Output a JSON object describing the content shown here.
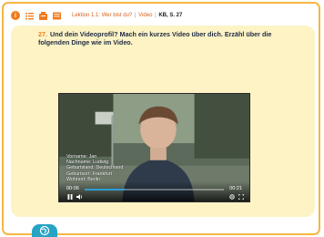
{
  "top_bar": {
    "icons": [
      "info-icon",
      "list-icon",
      "grid-icon",
      "book-icon"
    ],
    "breadcrumb": {
      "lesson": "Lektion 1.1: Wer bist du?",
      "separator": "|",
      "media": "Video",
      "kb": "KB, S. 27"
    }
  },
  "task": {
    "number": "27.",
    "text": "Und dein Videoprofil? Mach ein kurzes Video über dich. Erzähl über die folgenden Dinge wie im Video."
  },
  "video": {
    "caption_lines": [
      "Vorname: Jan",
      "Nachname: Ludwig",
      "Geburtsland: Deutschland",
      "Geburtsort: Frankfurt",
      "Wohnort: Berlin"
    ],
    "current_time": "00:06",
    "duration": "00:21",
    "progress": 0.29
  },
  "colors": {
    "frame_border": "#f4b642",
    "panel_bg": "#fdf3c5",
    "accent": "#f07c1e",
    "globe": "#27a3c4"
  }
}
